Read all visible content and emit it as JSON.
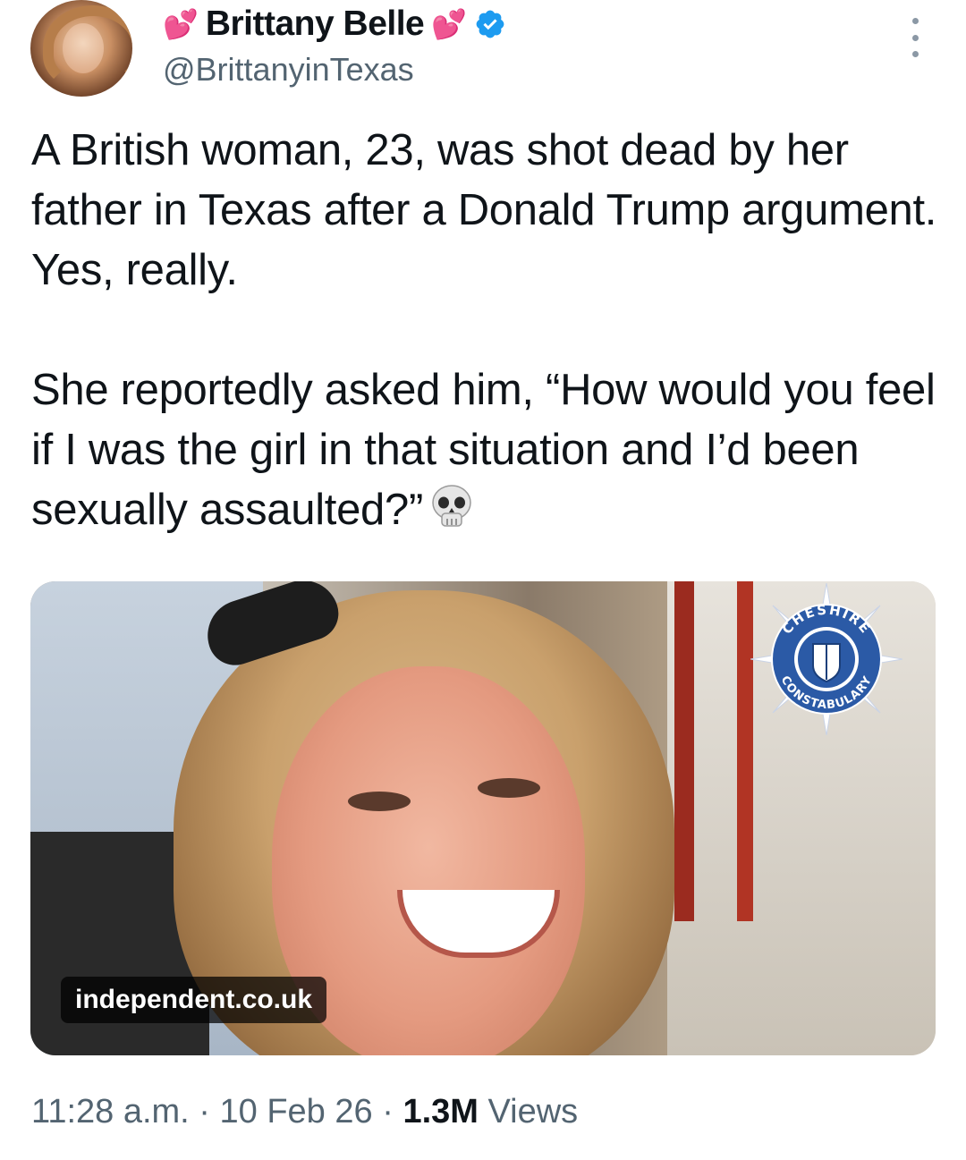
{
  "author": {
    "name": "Brittany Belle",
    "handle": "@BrittanyinTexas",
    "name_emoji": "💕",
    "verified_icon": "verified-badge-icon"
  },
  "tweet": {
    "paragraphs": [
      "A British woman, 23, was shot dead by her father in Texas after a Donald Trump argument. Yes, really.",
      "She reportedly asked him, “How would you feel if I was the girl in that situation and I’d been sexually assaulted?”"
    ],
    "trailing_emoji_icon": "skull-icon"
  },
  "media": {
    "source_label": "independent.co.uk",
    "badge_top_text": "CHESHIRE",
    "badge_bottom_text": "CONSTABULARY"
  },
  "meta": {
    "time": "11:28 a.m.",
    "date": "10 Feb 26",
    "views_count": "1.3M",
    "views_label": "Views",
    "separator": "·"
  },
  "colors": {
    "text": "#0f1419",
    "secondary": "#536471",
    "verified": "#1d9bf0",
    "heart": "#e66ad1"
  }
}
